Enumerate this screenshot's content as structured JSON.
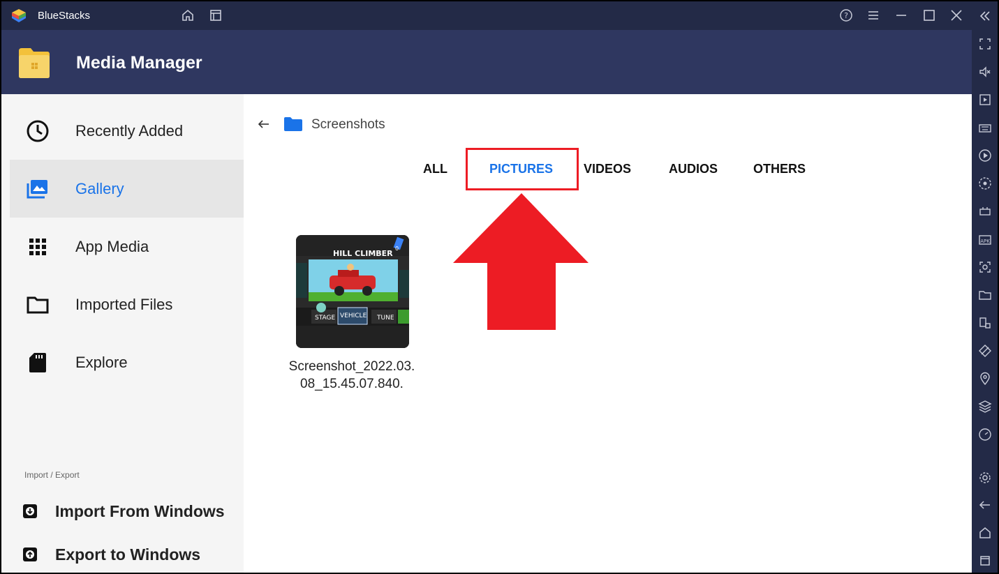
{
  "titlebar": {
    "app_name": "BlueStacks",
    "icons": [
      "home-icon",
      "multi-instance-icon",
      "help-icon",
      "menu-icon",
      "minimize-icon",
      "maximize-icon",
      "close-icon",
      "collapse-sidebar-icon"
    ]
  },
  "header": {
    "title": "Media Manager"
  },
  "sidebar": {
    "items": [
      {
        "label": "Recently Added",
        "icon": "clock-icon"
      },
      {
        "label": "Gallery",
        "icon": "gallery-icon"
      },
      {
        "label": "App Media",
        "icon": "grid-icon"
      },
      {
        "label": "Imported Files",
        "icon": "folder-icon"
      },
      {
        "label": "Explore",
        "icon": "sd-card-icon"
      }
    ],
    "import_export_header": "Import / Export",
    "import_label": "Import From Windows",
    "export_label": "Export to Windows"
  },
  "main": {
    "breadcrumb": "Screenshots",
    "tabs": [
      {
        "label": "ALL"
      },
      {
        "label": "PICTURES"
      },
      {
        "label": "VIDEOS"
      },
      {
        "label": "AUDIOS"
      },
      {
        "label": "OTHERS"
      }
    ],
    "active_tab": "PICTURES",
    "files": [
      {
        "caption": "Screenshot_2022.03.08_15.45.07.840.",
        "thumb_title": "HILL CLIMBER",
        "thumb_buttons": [
          "STAGE",
          "VEHICLE",
          "TUNE"
        ],
        "thumb_counter": "0"
      }
    ]
  },
  "colors": {
    "titlebar_bg": "#232a47",
    "header_bg": "#2f3760",
    "accent": "#1a73e8",
    "highlight_red": "#ed1c24"
  }
}
